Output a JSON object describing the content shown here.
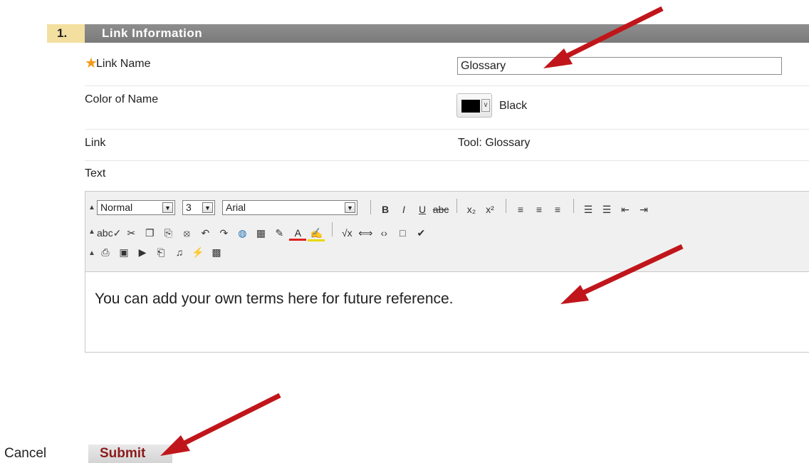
{
  "section": {
    "number": "1.",
    "title": "Link Information"
  },
  "fields": {
    "link_name": {
      "required_mark": "★",
      "label": "Link Name",
      "value": "Glossary"
    },
    "color_of_name": {
      "label": "Color of Name",
      "color_label": "Black",
      "color_hex": "#000000"
    },
    "link": {
      "label": "Link",
      "value": "Tool: Glossary"
    },
    "text": {
      "label": "Text"
    }
  },
  "editor": {
    "format_select": "Normal",
    "size_select": "3",
    "font_select": "Arial",
    "collapse_glyph": "▲",
    "row1_buttons": [
      {
        "name": "bold-icon",
        "glyph": "B"
      },
      {
        "name": "italic-icon",
        "glyph": "I"
      },
      {
        "name": "underline-icon",
        "glyph": "U"
      },
      {
        "name": "strikethrough-icon",
        "glyph": "abc"
      },
      {
        "name": "subscript-icon",
        "glyph": "x₂"
      },
      {
        "name": "superscript-icon",
        "glyph": "x²"
      },
      {
        "name": "align-left-icon",
        "glyph": "≡"
      },
      {
        "name": "align-center-icon",
        "glyph": "≡"
      },
      {
        "name": "align-right-icon",
        "glyph": "≡"
      },
      {
        "name": "numbered-list-icon",
        "glyph": "☰"
      },
      {
        "name": "bullet-list-icon",
        "glyph": "☰"
      },
      {
        "name": "outdent-icon",
        "glyph": "⇤"
      },
      {
        "name": "indent-icon",
        "glyph": "⇥"
      }
    ],
    "row2_buttons": [
      {
        "name": "spellcheck-icon",
        "glyph": "abc✓"
      },
      {
        "name": "cut-icon",
        "glyph": "✂"
      },
      {
        "name": "copy-icon",
        "glyph": "❐"
      },
      {
        "name": "paste-icon",
        "glyph": "⎘"
      },
      {
        "name": "unlink-icon",
        "glyph": "⦻"
      },
      {
        "name": "undo-icon",
        "glyph": "↶"
      },
      {
        "name": "redo-icon",
        "glyph": "↷"
      },
      {
        "name": "web-link-icon",
        "glyph": "◍"
      },
      {
        "name": "table-icon",
        "glyph": "▦"
      },
      {
        "name": "pencil-icon",
        "glyph": "✎"
      },
      {
        "name": "font-color-icon",
        "glyph": "A"
      },
      {
        "name": "highlight-icon",
        "glyph": "✍"
      },
      {
        "name": "math-icon",
        "glyph": "√x"
      },
      {
        "name": "html-icon",
        "glyph": "⟺"
      },
      {
        "name": "source-code-icon",
        "glyph": "‹›"
      },
      {
        "name": "preview-icon",
        "glyph": "□"
      },
      {
        "name": "check-link-icon",
        "glyph": "✔"
      }
    ],
    "row3_buttons": [
      {
        "name": "attach-file-icon",
        "glyph": "⎙"
      },
      {
        "name": "insert-image-icon",
        "glyph": "▣"
      },
      {
        "name": "insert-media-icon",
        "glyph": "▶"
      },
      {
        "name": "insert-file-icon",
        "glyph": "⎗"
      },
      {
        "name": "insert-audio-icon",
        "glyph": "♫"
      },
      {
        "name": "insert-flash-icon",
        "glyph": "⚡"
      },
      {
        "name": "mashup-icon",
        "glyph": "▩"
      }
    ],
    "content": "You can add your own terms here for future reference."
  },
  "buttons": {
    "cancel": "Cancel",
    "submit": "Submit"
  },
  "colors": {
    "section_number_bg": "#f3dfa0",
    "section_bar_bg": "#848484",
    "required_star": "#f29a1a",
    "submit_text": "#8c1b1b",
    "arrow": "#c0161b"
  }
}
